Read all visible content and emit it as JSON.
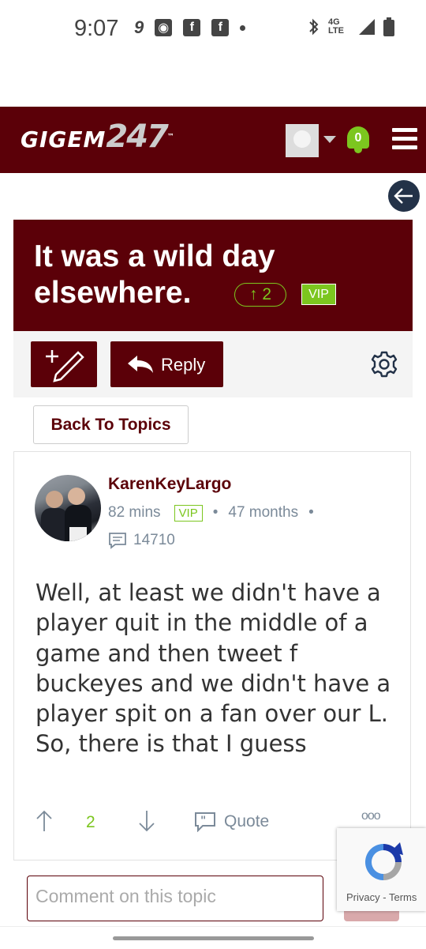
{
  "status_bar": {
    "time": "9:07",
    "left_icons": [
      "signal-9-icon",
      "camera-icon",
      "facebook-icon",
      "facebook-icon",
      "dot-icon"
    ],
    "right_icons": [
      "bluetooth-icon",
      "4g-lte-icon",
      "signal-icon",
      "battery-icon"
    ],
    "network_label": "4G LTE"
  },
  "header": {
    "logo_text": "GIGEM",
    "logo_number": "247",
    "logo_tm": "™",
    "notification_count": "0",
    "bg_color": "#5b0008",
    "accent_color": "#7cc61f"
  },
  "topic": {
    "title": "It was a wild day elsewhere.",
    "votes": "↑ 2",
    "badge": "VIP"
  },
  "toolbar": {
    "reply_label": "Reply",
    "back_to_topics_label": "Back To Topics"
  },
  "post": {
    "username": "KarenKeyLargo",
    "time_ago": "82 mins",
    "badge": "VIP",
    "member_age": "47 months",
    "comment_count": "14710",
    "body": "Well, at least we didn't have a player quit in the middle of a game and then tweet f buckeyes and we didn't have a player spit on a fan over our L. So, there is that I guess",
    "upvotes": "2",
    "quote_label": "Quote",
    "more_label": "ooo"
  },
  "comment_box": {
    "placeholder": "Comment on this topic"
  },
  "recaptcha": {
    "privacy": "Privacy",
    "separator": "-",
    "terms": "Terms"
  }
}
